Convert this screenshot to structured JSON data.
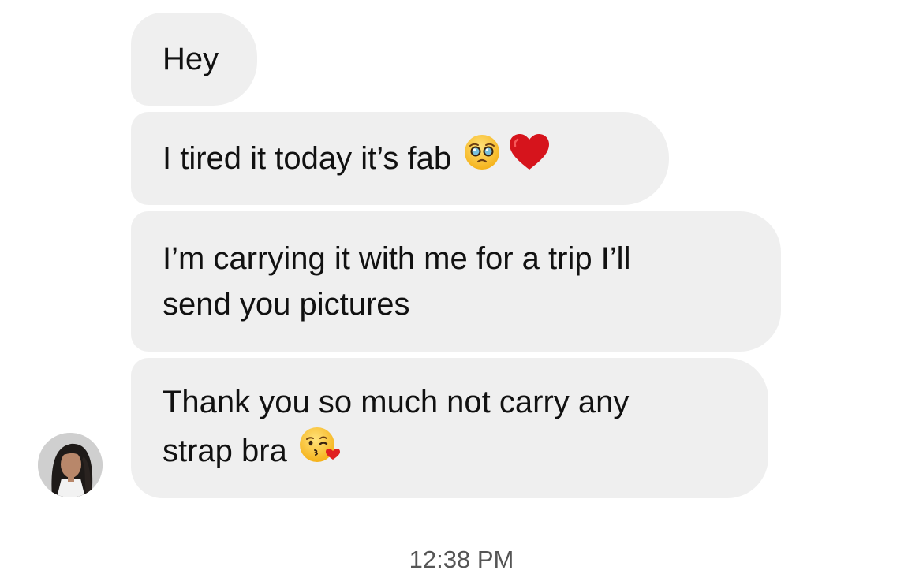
{
  "messages": [
    {
      "lines": [
        "Hey"
      ],
      "emojis": []
    },
    {
      "lines": [
        "I tired it today it’s fab"
      ],
      "emojis": [
        "pleading-face-emoji",
        "red-heart-emoji"
      ]
    },
    {
      "lines": [
        "I’m carrying it with me for a trip I’ll",
        "send you pictures"
      ],
      "emojis": []
    },
    {
      "lines": [
        "Thank you so much not carry any",
        "strap bra"
      ],
      "emojis": [
        "face-blowing-kiss-emoji"
      ]
    }
  ],
  "timestamp": "12:38 PM",
  "colors": {
    "bubble": "#efefef",
    "text": "#111111",
    "timestamp": "#555555",
    "background": "#ffffff"
  }
}
